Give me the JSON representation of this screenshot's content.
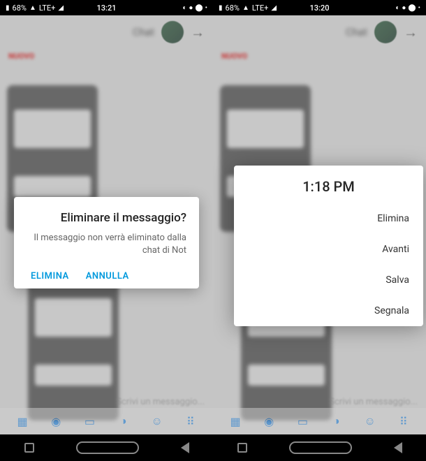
{
  "left": {
    "status": {
      "battery": "68%",
      "network": "LTE+",
      "time": "13:21"
    },
    "header": {
      "name": "Chat"
    },
    "red_label": "NUOVO",
    "dialog": {
      "title": "Eliminare il messaggio?",
      "text": "Il messaggio non verrà eliminato dalla chat di Not",
      "cancel": "ANNULLA",
      "confirm": "ELIMINA"
    },
    "input_placeholder": "Scrivi un messaggio..."
  },
  "right": {
    "status": {
      "battery": "68%",
      "network": "LTE+",
      "time": "13:20"
    },
    "header": {
      "name": "Chat"
    },
    "red_label": "NUOVO",
    "menu": {
      "time": "1:18 PM",
      "items": [
        "Elimina",
        "Avanti",
        "Salva",
        "Segnala"
      ]
    },
    "input_placeholder": "Scrivi un messaggio..."
  }
}
